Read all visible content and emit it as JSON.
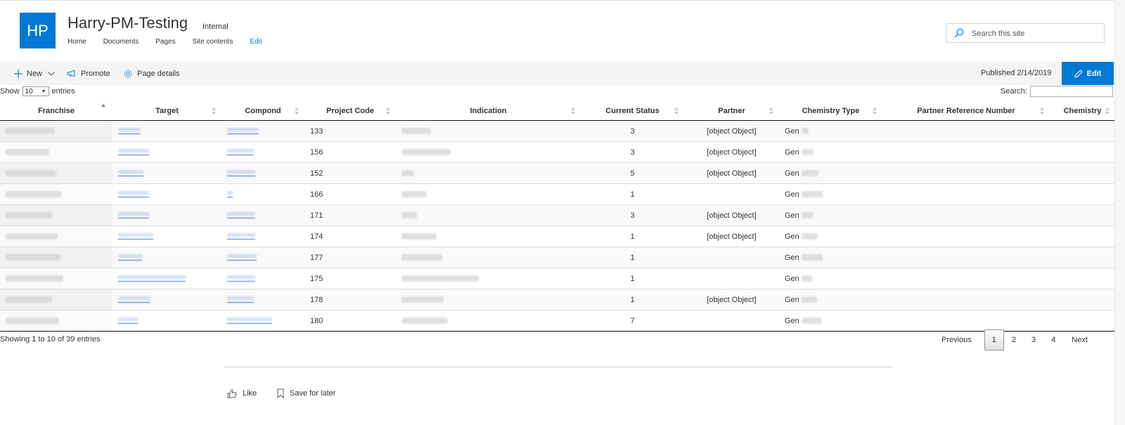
{
  "site": {
    "logo_text": "HP",
    "title": "Harry-PM-Testing",
    "badge": "Internal",
    "nav": [
      "Home",
      "Documents",
      "Pages",
      "Site contents"
    ],
    "nav_edit": "Edit",
    "search_placeholder": "Search this site"
  },
  "command_bar": {
    "new_label": "New",
    "promote_label": "Promote",
    "page_details_label": "Page details",
    "published": "Published 2/14/2019",
    "edit_label": "Edit"
  },
  "table": {
    "show_label": "Show",
    "length_value": "10",
    "entries_label": "entries",
    "search_label": "Search:",
    "headers": [
      "Franchise",
      "Target",
      "Compond",
      "Project Code",
      "Indication",
      "Current Status",
      "Partner",
      "Chemistry Type",
      "Partner Reference Number",
      "Chemistry"
    ],
    "rows": [
      {
        "project_code": "133",
        "current_status": "3",
        "partner": "[object Object]",
        "chemistry_type": "Gen"
      },
      {
        "project_code": "156",
        "current_status": "3",
        "partner": "[object Object]",
        "chemistry_type": "Gen"
      },
      {
        "project_code": "152",
        "current_status": "5",
        "partner": "[object Object]",
        "chemistry_type": "Gen"
      },
      {
        "project_code": "166",
        "current_status": "1",
        "partner": "",
        "chemistry_type": "Gen"
      },
      {
        "project_code": "171",
        "current_status": "3",
        "partner": "[object Object]",
        "chemistry_type": "Gen"
      },
      {
        "project_code": "174",
        "current_status": "1",
        "partner": "[object Object]",
        "chemistry_type": "Gen"
      },
      {
        "project_code": "177",
        "current_status": "1",
        "partner": "",
        "chemistry_type": "Gen"
      },
      {
        "project_code": "175",
        "current_status": "1",
        "partner": "",
        "chemistry_type": "Gen"
      },
      {
        "project_code": "178",
        "current_status": "1",
        "partner": "[object Object]",
        "chemistry_type": "Gen"
      },
      {
        "project_code": "180",
        "current_status": "7",
        "partner": "",
        "chemistry_type": "Gen"
      }
    ],
    "info": "Showing 1 to 10 of 39 entries",
    "pagination": {
      "previous": "Previous",
      "pages": [
        "1",
        "2",
        "3",
        "4"
      ],
      "current": "1",
      "next": "Next"
    }
  },
  "footer": {
    "like_label": "Like",
    "save_label": "Save for later"
  },
  "colors": {
    "accent": "#0078d4",
    "header_bar": "#f4f4f4"
  }
}
